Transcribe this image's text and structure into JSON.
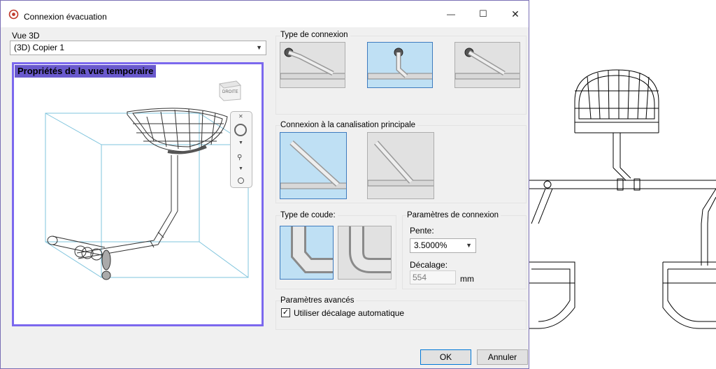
{
  "window": {
    "title": "Connexion évacuation",
    "minimize_symbol": "—",
    "maximize_symbol": "☐",
    "close_symbol": "✕"
  },
  "vue3d": {
    "label": "Vue 3D",
    "selected": "(3D) Copier 1"
  },
  "viewport": {
    "banner": "Propriétés de la vue temporaire",
    "viewcube_face": "DROITE"
  },
  "type_connexion": {
    "label": "Type de connexion",
    "options": [
      "type-1",
      "type-2",
      "type-3"
    ],
    "selected_index": 1
  },
  "connexion_canalisation": {
    "label": "Connexion à la canalisation principale",
    "selected_index": 0
  },
  "type_coude": {
    "label": "Type de coude:",
    "selected_index": 0
  },
  "parametres_connexion": {
    "label": "Paramètres de connexion",
    "pente_label": "Pente:",
    "pente_value": "3.5000%",
    "decalage_label": "Décalage:",
    "decalage_value": "554",
    "decalage_unit": "mm"
  },
  "parametres_avances": {
    "label": "Paramètres avancés",
    "auto_offset_label": "Utiliser décalage automatique",
    "auto_offset_checked": true
  },
  "buttons": {
    "ok": "OK",
    "cancel": "Annuler"
  },
  "colors": {
    "accent": "#0078d7",
    "viewport_border": "#7b68ee",
    "banner_bg": "#6a5acd",
    "selected_thumb": "#bfe0f4"
  }
}
